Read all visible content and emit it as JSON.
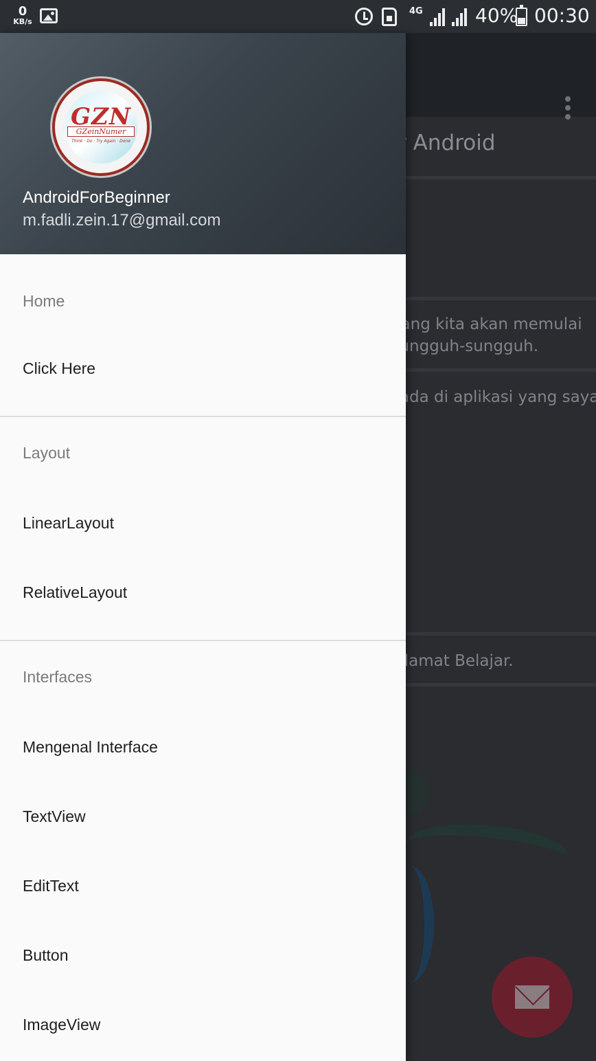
{
  "status_bar": {
    "speed_value": "0",
    "speed_unit": "KB/s",
    "network": "4G",
    "battery": "40%",
    "time": "00:30",
    "icons": [
      "image-icon",
      "alarm-icon",
      "sim-icon",
      "signal-icon",
      "battery-icon"
    ]
  },
  "background": {
    "heading": "er Android",
    "text_line1": "arang kita akan memulai",
    "text_line2": "rsungguh-sungguh.",
    "text_line3": "g ada di aplikasi yang saya",
    "text_line4": "Selamat Belajar.",
    "fab_icon": "mail-icon"
  },
  "drawer": {
    "header": {
      "name": "AndroidForBeginner",
      "email": "m.fadli.zein.17@gmail.com",
      "logo_text": "GZN",
      "logo_sub": "GZeinNumer",
      "logo_tag": "Think · Do · Try Again · Done"
    },
    "sections": [
      {
        "title": "Home",
        "items": [
          "Click Here"
        ]
      },
      {
        "title": "Layout",
        "items": [
          "LinearLayout",
          "RelativeLayout"
        ]
      },
      {
        "title": "Interfaces",
        "items": [
          "Mengenal Interface",
          "TextView",
          "EditText",
          "Button",
          "ImageView"
        ]
      }
    ]
  },
  "colors": {
    "header_gradient_start": "#525d66",
    "header_gradient_end": "#2b3137",
    "drawer_bg": "#fafafa",
    "fab": "#6a1f2d"
  }
}
